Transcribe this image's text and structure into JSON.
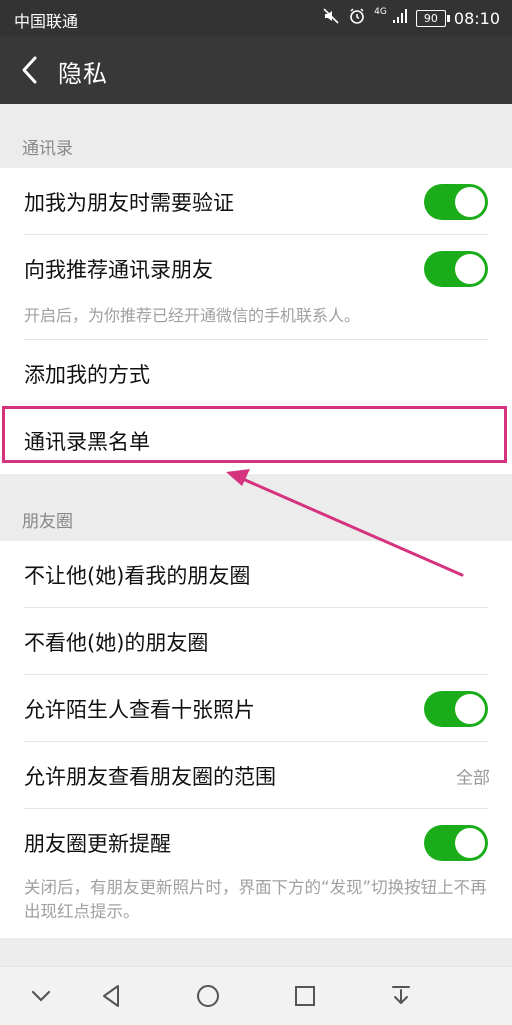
{
  "status_bar": {
    "carrier": "中国联通",
    "network": "4G",
    "battery": "90",
    "time": "08:10"
  },
  "header": {
    "title": "隐私"
  },
  "contacts_section": {
    "label": "通讯录",
    "items": [
      {
        "label": "加我为朋友时需要验证",
        "toggle": true
      },
      {
        "label": "向我推荐通讯录朋友",
        "toggle": true
      }
    ],
    "recommend_desc": "开启后，为你推荐已经开通微信的手机联系人。",
    "add_me_ways": "添加我的方式",
    "blacklist": "通讯录黑名单"
  },
  "moments_section": {
    "label": "朋友圈",
    "block_see_mine": "不让他(她)看我的朋友圈",
    "hide_theirs": "不看他(她)的朋友圈",
    "stranger_ten_photos": {
      "label": "允许陌生人查看十张照片",
      "toggle": true
    },
    "friends_view_range": {
      "label": "允许朋友查看朋友圈的范围",
      "value": "全部"
    },
    "update_reminder": {
      "label": "朋友圈更新提醒",
      "toggle": true
    },
    "update_desc": "关闭后，有朋友更新照片时，界面下方的“发现”切换按钮上不再出现红点提示。"
  },
  "colors": {
    "accent_green": "#1aad19",
    "highlight_pink": "#d6337f",
    "header_bg": "#383838"
  }
}
